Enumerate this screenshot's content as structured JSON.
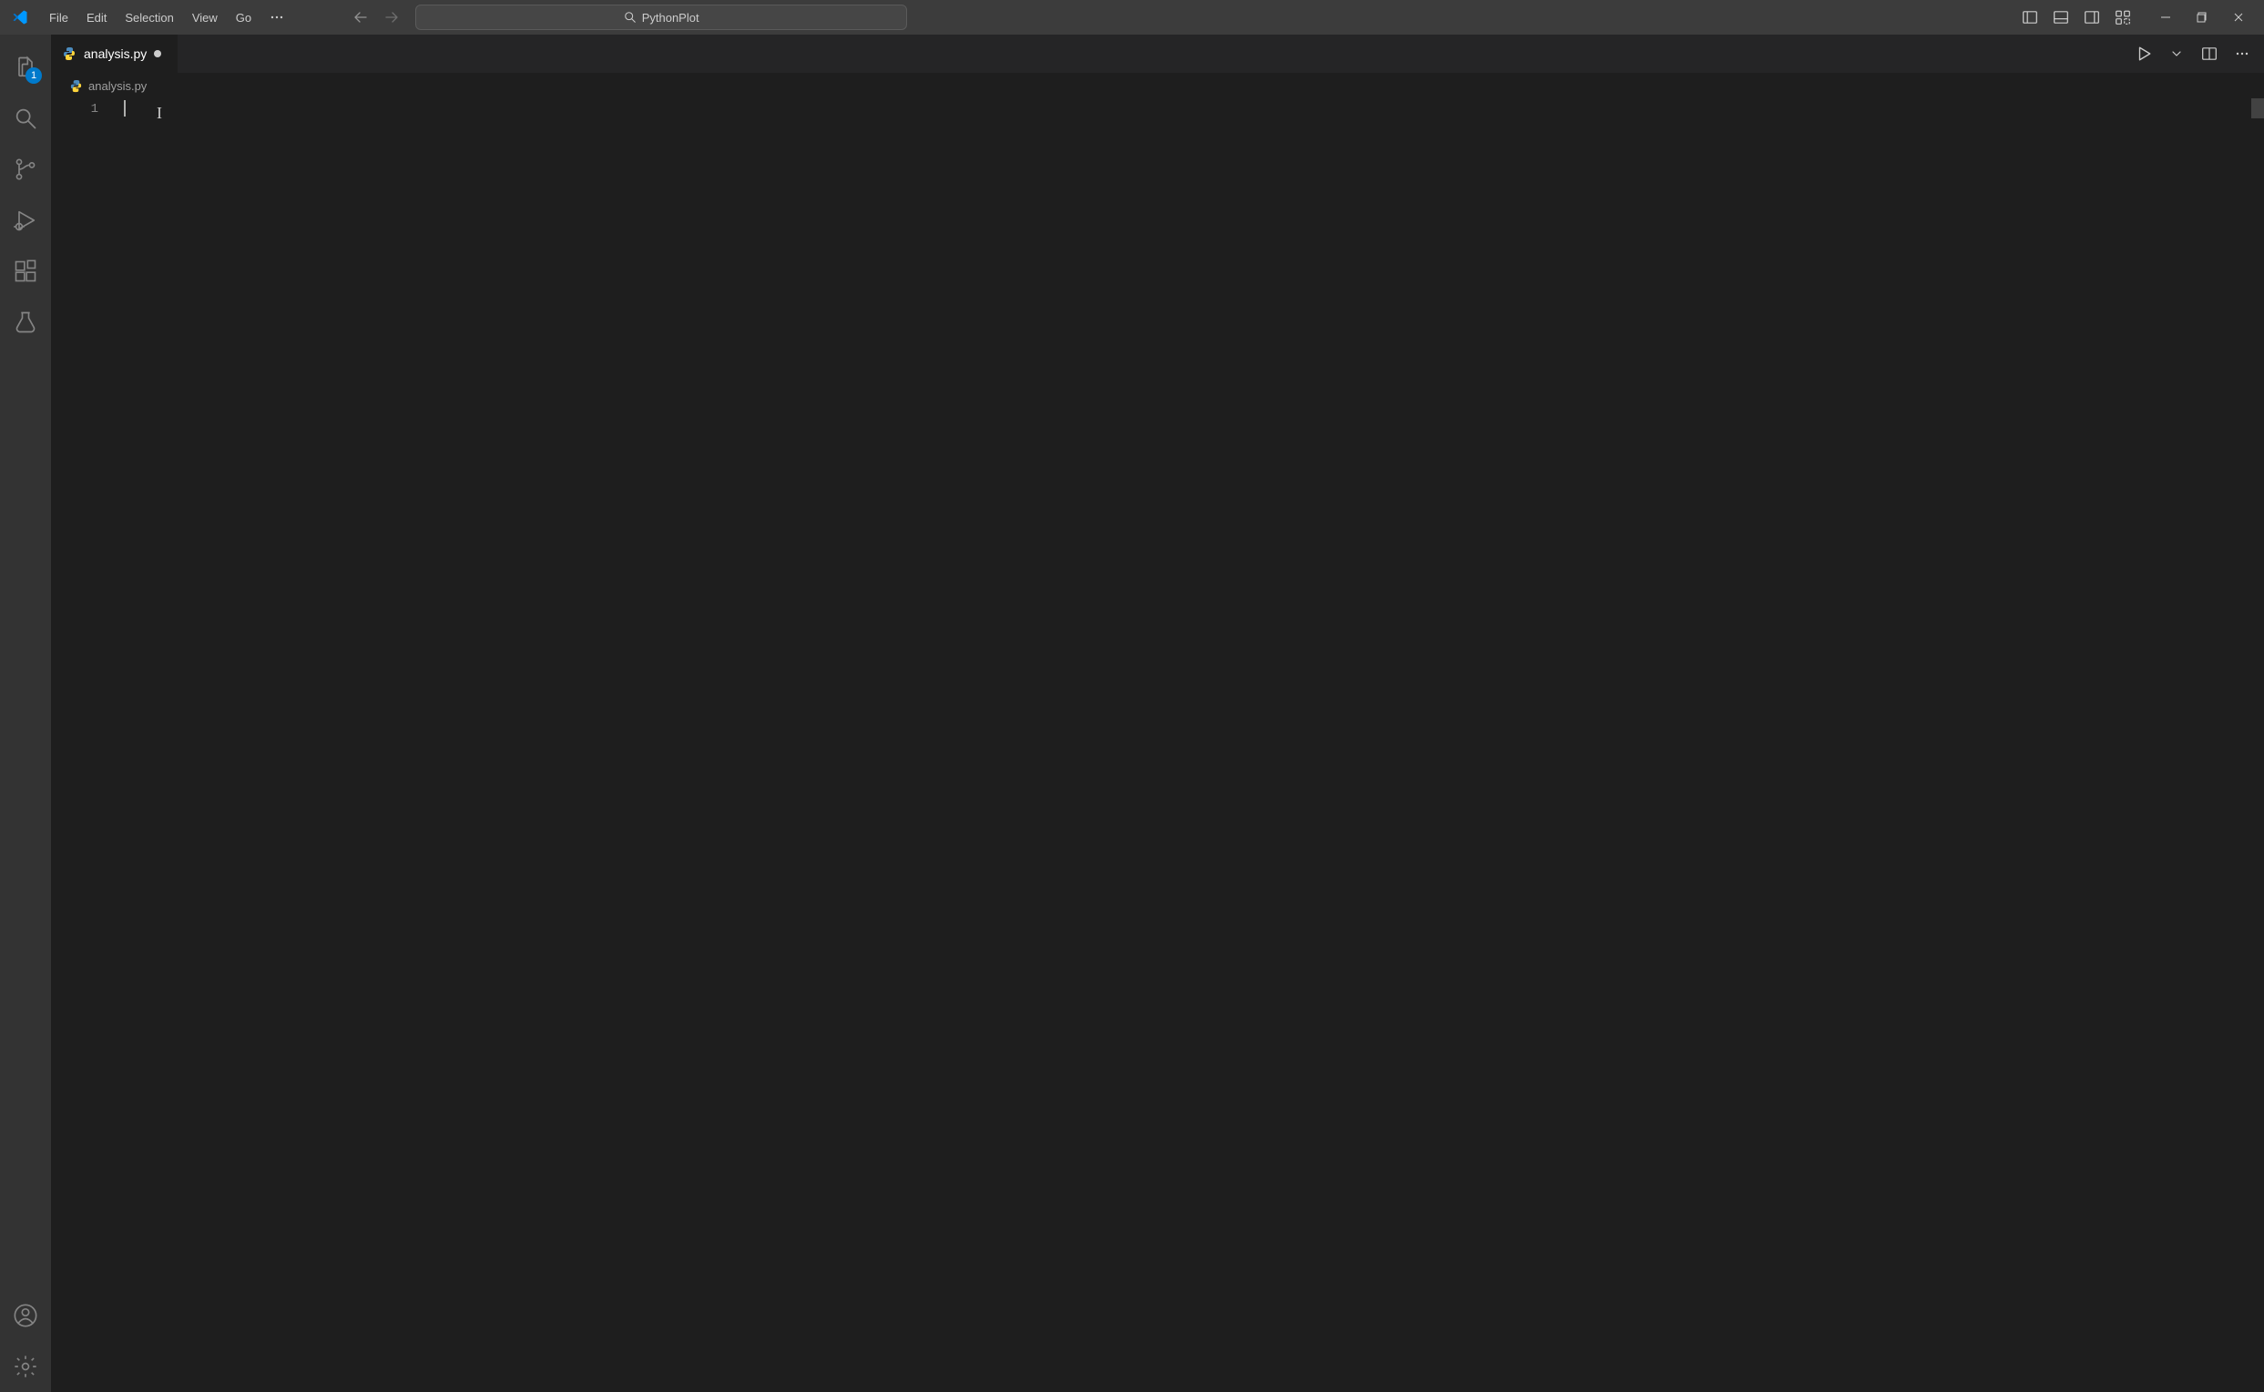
{
  "menu": {
    "items": [
      "File",
      "Edit",
      "Selection",
      "View",
      "Go"
    ]
  },
  "search": {
    "text": "PythonPlot"
  },
  "activity": {
    "explorer_badge": "1"
  },
  "tabs": {
    "items": [
      {
        "label": "analysis.py",
        "dirty": true
      }
    ]
  },
  "breadcrumb": {
    "file": "analysis.py"
  },
  "editor": {
    "line_numbers": [
      "1"
    ]
  }
}
